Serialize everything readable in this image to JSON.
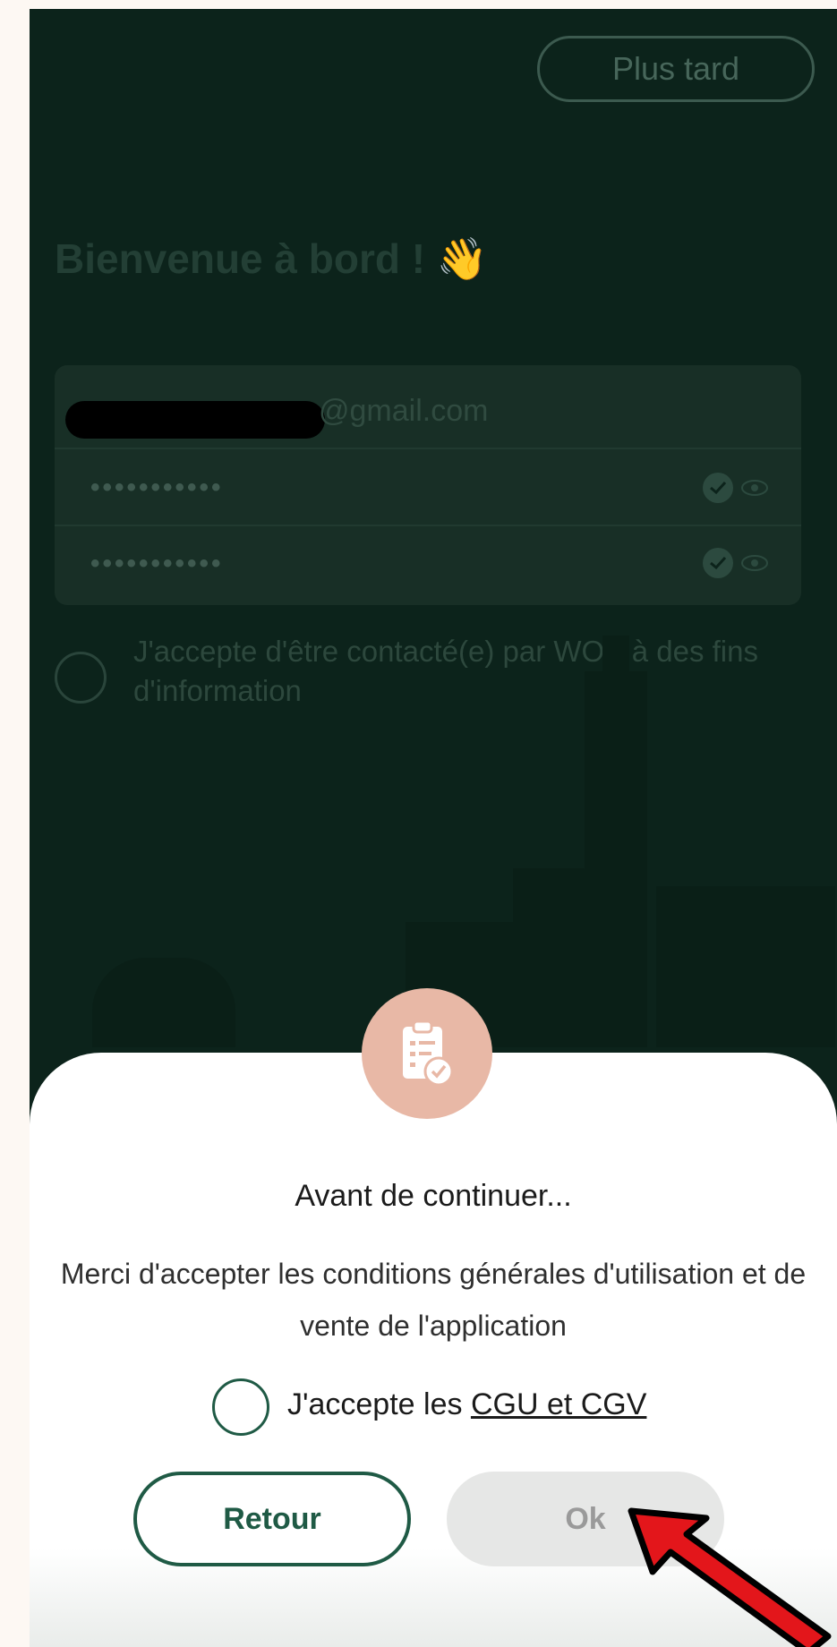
{
  "header": {
    "later_label": "Plus tard"
  },
  "welcome": {
    "title": "Bienvenue à bord !",
    "wave_emoji": "👋"
  },
  "form": {
    "email_suffix": "@gmail.com",
    "password_mask": "•••••••••••",
    "confirm_mask": "•••••••••••"
  },
  "consent": {
    "label": "J'accepte d'être contacté(e) par WOP à des fins d'information"
  },
  "modal": {
    "icon": "clipboard-check-icon",
    "title": "Avant de continuer...",
    "message": "Merci d'accepter les conditions générales d'utilisation et de vente de l'application",
    "terms_prefix": "J'accepte les",
    "terms_link": "CGU et CGV",
    "back_label": "Retour",
    "ok_label": "Ok"
  },
  "colors": {
    "brand_green": "#1f5a45",
    "overlay_bg": "#0c231b",
    "icon_circle": "#e8b8a6",
    "annotation_arrow": "#e3161b"
  }
}
